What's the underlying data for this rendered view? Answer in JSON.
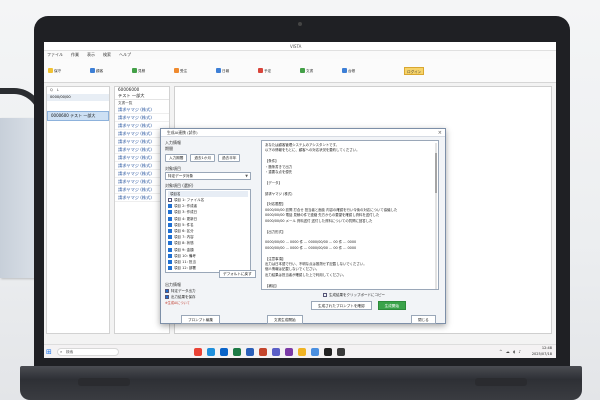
{
  "window": {
    "title": "VISTA"
  },
  "menu": [
    "ファイル",
    "作業",
    "表示",
    "検索",
    "ヘルプ"
  ],
  "ribbon": [
    {
      "icon": "yellow",
      "label": "保守"
    },
    {
      "icon": "blue",
      "label": "顧客"
    },
    {
      "icon": "green",
      "label": "見積"
    },
    {
      "icon": "orange",
      "label": "受注"
    },
    {
      "icon": "blue",
      "label": "日報"
    },
    {
      "icon": "red",
      "label": "予定"
    },
    {
      "icon": "green",
      "label": "文書"
    },
    {
      "icon": "blue",
      "label": "台帳"
    }
  ],
  "ribbon_highlight": "ログイン",
  "left_panel": {
    "tabs": [
      "Q",
      "L"
    ],
    "header": "0000/00/00",
    "selected_row": "0000600 テスト 一部大"
  },
  "mid_panel": {
    "top_line1": "60006000",
    "top_line2": "テスト 一部大",
    "column_label": "文書一覧",
    "rows": [
      "請求ヤマジ (株式)",
      "請求ヤマジ (株式)",
      "請求ヤマジ (株式)",
      "請求ヤマジ (株式)",
      "請求ヤマジ (株式)",
      "請求ヤマジ (株式)",
      "請求ヤマジ (株式)",
      "請求ヤマジ (株式)",
      "請求ヤマジ (株式)",
      "請求ヤマジ (株式)",
      "請求ヤマジ (株式)",
      "請求ヤマジ (株式)"
    ]
  },
  "dialog": {
    "title": "生成AI連携 (試作)",
    "section_period": "入力情報",
    "period_label": "期間",
    "period_buttons": [
      "入力期間",
      "過去1か月",
      "過去半年"
    ],
    "section_target": "対象項目",
    "target_dropdown": "特定データ対象",
    "section_items": "対象項目 (選択)",
    "checklist_head": "項目名",
    "items": [
      {
        "label": "項目 1: ファイル名",
        "checked": false
      },
      {
        "label": "項目 2: 作成者",
        "checked": true
      },
      {
        "label": "項目 3: 作成日",
        "checked": true
      },
      {
        "label": "項目 4: 更新日",
        "checked": true
      },
      {
        "label": "項目 5: 件名",
        "checked": true
      },
      {
        "label": "項目 6: 区分",
        "checked": true
      },
      {
        "label": "項目 7: 内容",
        "checked": true
      },
      {
        "label": "項目 8: 状態",
        "checked": true
      },
      {
        "label": "項目 9: 金額",
        "checked": true
      },
      {
        "label": "項目 10: 備考",
        "checked": true
      },
      {
        "label": "項目 11: 担当",
        "checked": true
      },
      {
        "label": "項目 12: 部署",
        "checked": true
      }
    ],
    "default_button": "デフォルトに戻す",
    "section_output": "出力情報",
    "output_options": [
      "特定データ出力",
      "出力結果を保存"
    ],
    "red_note": "※生成AIについて",
    "prompt_lines": [
      "あなたは顧客管理システムのアシスタントです。",
      "以下の情報をもとに、顧客への対応状況を要約してください。",
      "",
      "【条件】",
      "・箇条書きで出力",
      "・重要な点を優先",
      "",
      "【データ】",
      "",
      "請求ヤマジ (株式)",
      "",
      "【対応履歴】",
      "0000/00/00 訪問 打合せ 担当者と面談 内容の確認を行い今後の対応について協議した",
      "0000/00/00 電話 見積の件で連絡 先方からの要望を確認し資料を送付した",
      "0000/00/00 メール 資料送付 送付した資料についての質問に回答した",
      "",
      "【出力形式】",
      "",
      "0000/00/00 ... 0000 件 ... 0000/00/00 ... 00 件 ... 0000",
      "0000/00/00 ... 0000 件 ... 0000/00/00 ... 00 件 ... 0000",
      "",
      "【注意事項】",
      "出力は日本語で行い、不明な点は推測せず記載しないでください。",
      "個人情報は記載しないでください。",
      "出力結果は担当者が確認した上で利用してください。",
      "",
      "【補足】",
      "上記以外の情報が必要な場合は、担当者に確認してください。",
      "以上の内容を踏まえ、わかりやすく要約してください。",
      "",
      "0000/00/00 ... 0000 件",
      "0000/00/00 ... 0000 件"
    ],
    "copy_check": "生成結果をクリップボードにコピー",
    "copy_button": "生成されたプロンプトを確認",
    "run_button": "生成開始",
    "prompt_edit_button": "プロンプト編集",
    "doc_gen_button": "文書生成開始",
    "close_button": "閉じる"
  },
  "taskbar": {
    "search_placeholder": "検索",
    "icons": [
      "chrome",
      "edge",
      "outlook",
      "excel",
      "word",
      "powerpoint",
      "teams",
      "onenote",
      "explorer",
      "files",
      "media",
      "store"
    ],
    "time": "12:48",
    "date": "2025/07/18"
  },
  "colors": {
    "accent": "#1f6fd1",
    "green_button": "#3aa34a",
    "ribbon_highlight": "#f6d36a",
    "selection": "#cde0f4"
  }
}
